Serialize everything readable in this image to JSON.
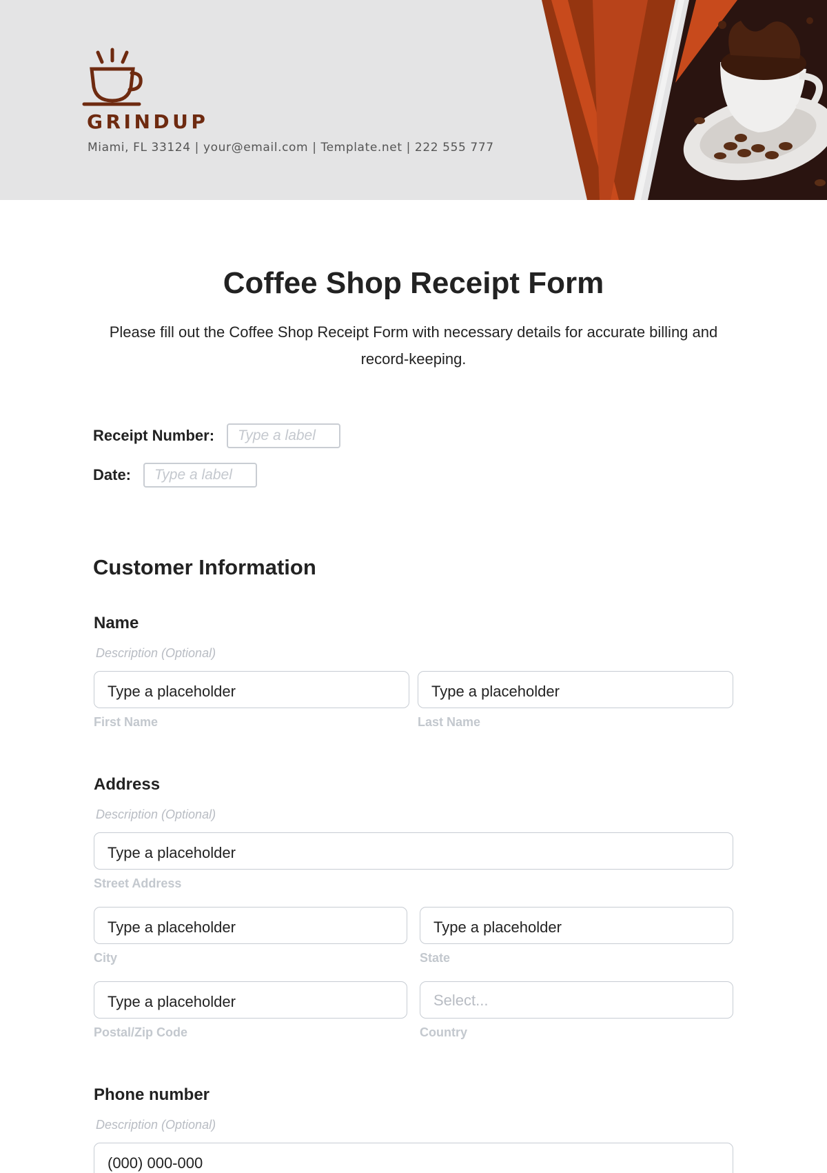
{
  "header": {
    "brand": "GRINDUP",
    "contact": "Miami, FL 33124 | your@email.com | Template.net | 222 555 777",
    "icons": {
      "logo": "coffee-cup-icon",
      "photo": "coffee-cup-splash-image"
    },
    "colors": {
      "brand": "#6e2a10",
      "banner_dark": "#2a1410",
      "banner_orange": "#c84a1c",
      "banner_rust": "#953510"
    }
  },
  "form": {
    "title": "Coffee Shop Receipt Form",
    "description": "Please fill out the Coffee Shop Receipt Form with necessary details for accurate billing and record-keeping.",
    "receipt_number": {
      "label": "Receipt Number:",
      "placeholder": "Type a label"
    },
    "date": {
      "label": "Date:",
      "placeholder": "Type a label"
    }
  },
  "customer": {
    "section_title": "Customer Information",
    "name": {
      "label": "Name",
      "description": "Description (Optional)",
      "first": {
        "value": "Type a placeholder",
        "sublabel": "First Name"
      },
      "last": {
        "value": "Type a placeholder",
        "sublabel": "Last Name"
      }
    },
    "address": {
      "label": "Address",
      "description": "Description (Optional)",
      "street": {
        "value": "Type a placeholder",
        "sublabel": "Street Address"
      },
      "city": {
        "value": "Type a placeholder",
        "sublabel": "City"
      },
      "state": {
        "value": "Type a placeholder",
        "sublabel": "State"
      },
      "postal": {
        "value": "Type a placeholder",
        "sublabel": "Postal/Zip Code"
      },
      "country": {
        "value": "Select...",
        "sublabel": "Country"
      }
    },
    "phone": {
      "label": "Phone number",
      "description": "Description (Optional)",
      "value": "(000) 000-000"
    }
  }
}
